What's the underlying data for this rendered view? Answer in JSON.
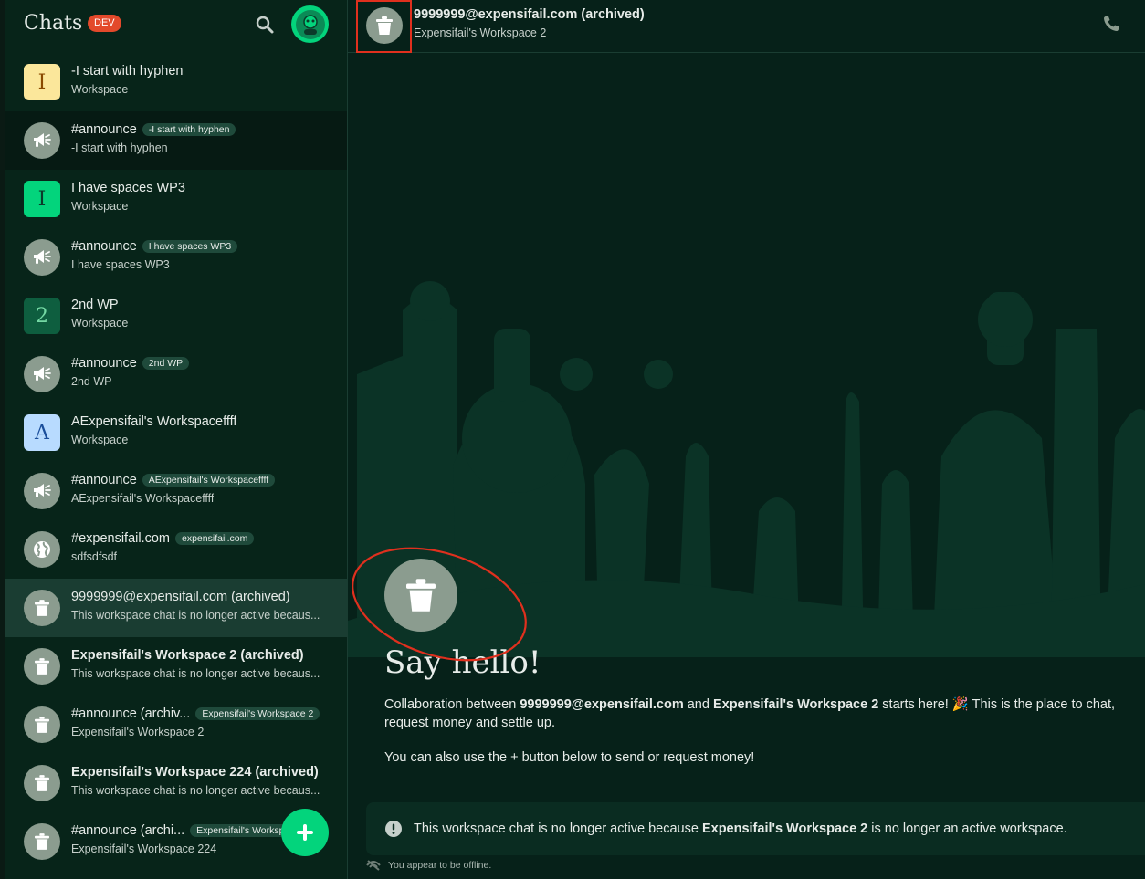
{
  "sidebar": {
    "title": "Chats",
    "badge": "DEV",
    "items": [
      {
        "name": "-I start with hyphen",
        "sub": "Workspace",
        "avatar": "I",
        "avatar_bg": "#fbe79b",
        "avatar_fg": "#8a4a00"
      },
      {
        "name": "#announce",
        "tag": "-I start with hyphen",
        "sub": "-I start with hyphen",
        "icon": "megaphone-icon"
      },
      {
        "name": "I have spaces WP3",
        "sub": "Workspace",
        "avatar": "I",
        "avatar_bg": "#03d47c",
        "avatar_fg": "#0b3b2a"
      },
      {
        "name": "#announce",
        "tag": "I have spaces WP3",
        "sub": "I have spaces WP3",
        "icon": "megaphone-icon"
      },
      {
        "name": "2nd WP",
        "sub": "Workspace",
        "avatar": "2",
        "avatar_bg": "#0e5e3f",
        "avatar_fg": "#74d9a4"
      },
      {
        "name": "#announce",
        "tag": "2nd WP",
        "sub": "2nd WP",
        "icon": "megaphone-icon"
      },
      {
        "name": "AExpensifail's Workspaceffff",
        "sub": "Workspace",
        "avatar": "A",
        "avatar_bg": "#b8dbff",
        "avatar_fg": "#1a4e9b"
      },
      {
        "name": "#announce",
        "tag": "AExpensifail's Workspaceffff",
        "sub": "AExpensifail's Workspaceffff",
        "icon": "megaphone-icon"
      },
      {
        "name": "#expensifail.com",
        "tag": "expensifail.com",
        "sub": "sdfsdfsdf",
        "icon": "globe-icon"
      },
      {
        "name": "9999999@expensifail.com (archived)",
        "sub": "This workspace chat is no longer active becaus...",
        "icon": "trash-icon"
      },
      {
        "name": "Expensifail's Workspace 2 (archived)",
        "sub": "This workspace chat is no longer active becaus...",
        "icon": "trash-icon",
        "bold": true
      },
      {
        "name": "#announce (archiv...",
        "tag": "Expensifail's Workspace 2",
        "sub": "Expensifail's Workspace 2",
        "icon": "trash-icon"
      },
      {
        "name": "Expensifail's Workspace 224 (archived)",
        "sub": "This workspace chat is no longer active becaus...",
        "icon": "trash-icon",
        "bold": true
      },
      {
        "name": "#announce (archi...",
        "tag": "Expensifail's Workspace 224",
        "sub": "Expensifail's Workspace 224",
        "icon": "trash-icon"
      }
    ]
  },
  "header": {
    "title": "9999999@expensifail.com (archived)",
    "subtitle": "Expensifail's Workspace 2"
  },
  "welcome": {
    "heading": "Say hello!",
    "line1_pre": "Collaboration between ",
    "line1_user": "9999999@expensifail.com",
    "line1_mid": " and ",
    "line1_ws": "Expensifail's Workspace 2",
    "line1_post": " starts here! 🎉 This is the place to chat, request money and settle up.",
    "line2": "You can also use the + button below to send or request money!"
  },
  "notice": {
    "pre": "This workspace chat is no longer active because ",
    "ws": "Expensifail's Workspace 2",
    "post": " is no longer an active workspace."
  },
  "offline": "You appear to be offline.",
  "colors": {
    "accent": "#03d47c",
    "annotation": "#e0301e",
    "dev_badge": "#e3492b"
  }
}
